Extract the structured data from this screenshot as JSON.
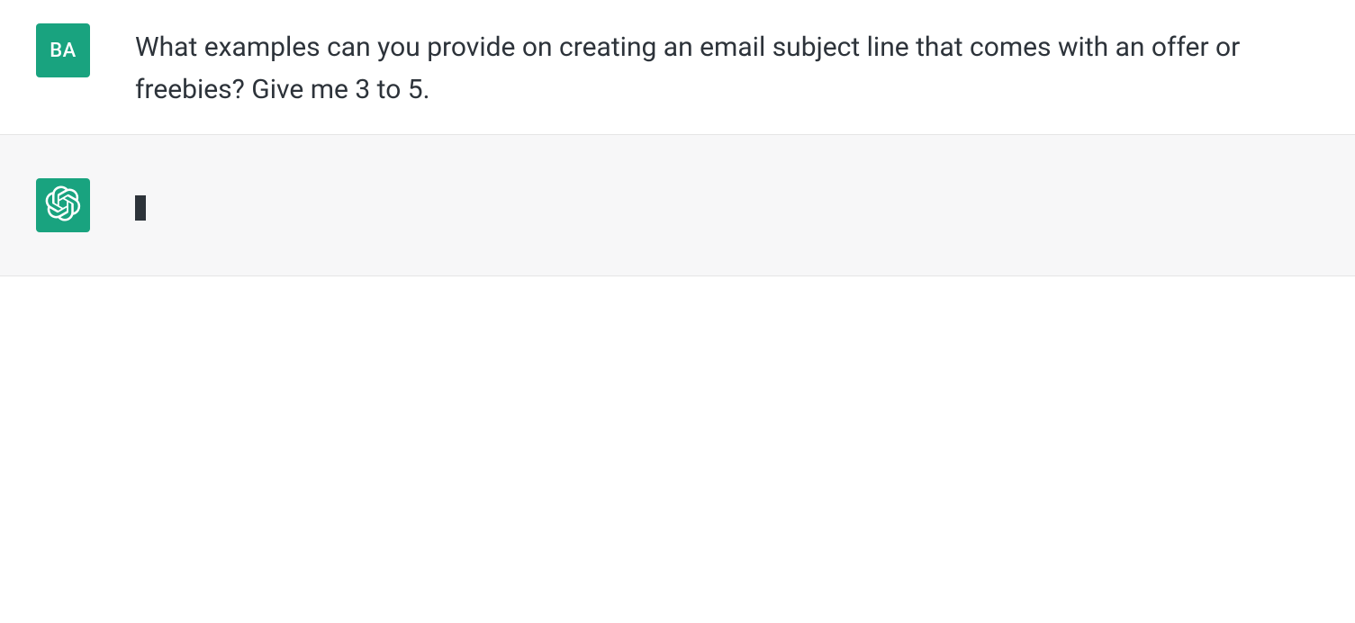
{
  "conversation": {
    "user": {
      "avatar_initials": "BA",
      "message": "What examples can you provide on creating an email subject line that comes with an offer or freebies? Give me 3 to 5."
    },
    "assistant": {
      "message": ""
    }
  },
  "colors": {
    "avatar_bg": "#19a37f",
    "assistant_row_bg": "#f7f7f8",
    "border": "#e5e5e5",
    "text": "#2d333a"
  }
}
